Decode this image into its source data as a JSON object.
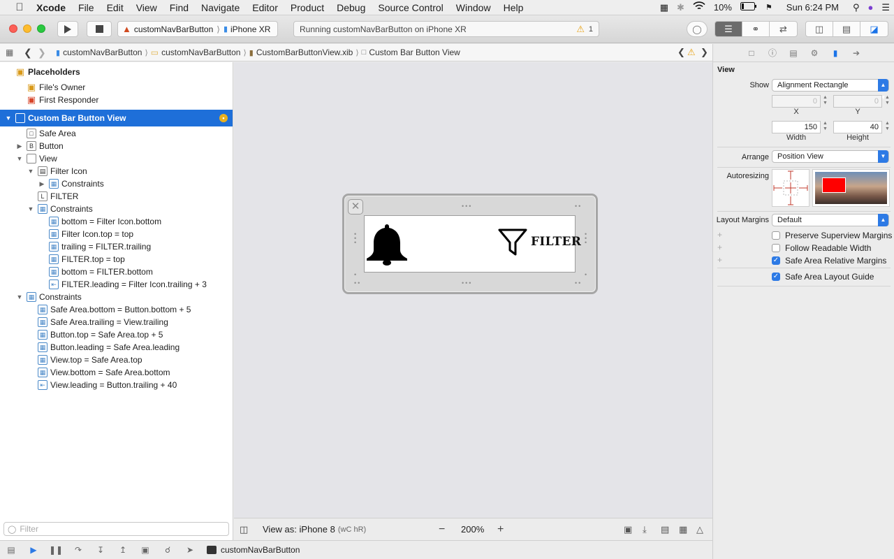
{
  "menubar": {
    "app": "Xcode",
    "items": [
      "File",
      "Edit",
      "View",
      "Find",
      "Navigate",
      "Editor",
      "Product",
      "Debug",
      "Source Control",
      "Window",
      "Help"
    ],
    "battery": "10%",
    "clock": "Sun 6:24 PM"
  },
  "toolbar": {
    "scheme": "customNavBarButton",
    "device": "iPhone XR",
    "activity": "Running customNavBarButton on iPhone XR",
    "warning_count": "1"
  },
  "jumpbar": {
    "crumbs": [
      "customNavBarButton",
      "customNavBarButton",
      "CustomBarButtonView.xib",
      "Custom Bar Button View"
    ]
  },
  "navigator": {
    "placeholders": "Placeholders",
    "files_owner": "File's Owner",
    "first_responder": "First Responder",
    "root": "Custom Bar Button View",
    "safe_area": "Safe Area",
    "button": "Button",
    "view": "View",
    "filter_icon": "Filter Icon",
    "constraints": "Constraints",
    "filter": "FILTER",
    "view_constraints": [
      "bottom = Filter Icon.bottom",
      "Filter Icon.top = top",
      "trailing = FILTER.trailing",
      "FILTER.top = top",
      "bottom = FILTER.bottom",
      "FILTER.leading = Filter Icon.trailing + 3"
    ],
    "root_constraints": [
      "Safe Area.bottom = Button.bottom + 5",
      "Safe Area.trailing = View.trailing",
      "Button.top = Safe Area.top + 5",
      "Button.leading = Safe Area.leading",
      "View.top = Safe Area.top",
      "View.bottom = Safe Area.bottom",
      "View.leading = Button.trailing + 40"
    ],
    "filter_placeholder": "Filter"
  },
  "canvas": {
    "label_text": "FILTER",
    "view_as": "View as: iPhone 8",
    "size_class": "(wC hR)",
    "zoom": "200%"
  },
  "inspector": {
    "section": "View",
    "show_label": "Show",
    "show_value": "Alignment Rectangle",
    "x_value": "0",
    "y_value": "0",
    "x_caption": "X",
    "y_caption": "Y",
    "width_value": "150",
    "height_value": "40",
    "width_caption": "Width",
    "height_caption": "Height",
    "arrange_label": "Arrange",
    "arrange_value": "Position View",
    "autoresizing_label": "Autoresizing",
    "layout_margins_label": "Layout Margins",
    "layout_margins_value": "Default",
    "checkboxes": [
      {
        "label": "Preserve Superview Margins",
        "checked": false
      },
      {
        "label": "Follow Readable Width",
        "checked": false
      },
      {
        "label": "Safe Area Relative Margins",
        "checked": true
      },
      {
        "label": "Safe Area Layout Guide",
        "checked": true
      }
    ]
  },
  "debugbar": {
    "target": "customNavBarButton"
  },
  "colors": {
    "selection": "#1e6fd9",
    "accent": "#2d7ae5",
    "warning": "#e8a317",
    "autoresize_preview": "#ff0000"
  }
}
